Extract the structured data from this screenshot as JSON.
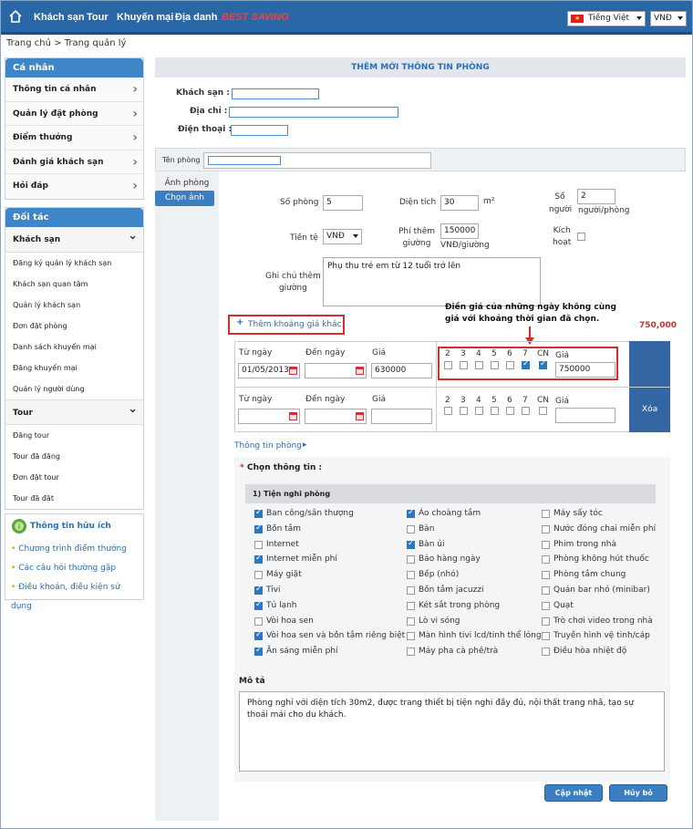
{
  "nav": {
    "items": [
      "Khách sạn",
      "Tour",
      "Khuyến mại",
      "Địa danh"
    ],
    "best": "BEST SAVING",
    "language": "Tiếng Việt",
    "currency": "VNĐ"
  },
  "breadcrumb": {
    "home": "Trang chủ",
    "separator": ">",
    "current": "Trang quản lý"
  },
  "sidebar": {
    "personal_title": "Cá nhân",
    "personal_items": [
      "Thông tin cá nhân",
      "Quản lý đặt phòng",
      "Điểm thưởng",
      "Đánh giá khách sạn",
      "Hỏi đáp"
    ],
    "partner_title": "Đối tác",
    "hotel_group": "Khách sạn",
    "hotel_items": [
      "Đăng ký quản lý khách sạn",
      "Khách sạn quan tâm",
      "Quản lý khách sạn",
      "Đơn đặt phòng",
      "Danh sách khuyến mại",
      "Đăng khuyến mại",
      "Quản lý người dùng"
    ],
    "tour_group": "Tour",
    "tour_items": [
      "Đăng tour",
      "Tour đã đăng",
      "Đơn đặt tour",
      "Tour đã đặt"
    ],
    "info_title": "Thông tin hữu ích",
    "info_links": [
      "Chương trình điểm thưởng",
      "Các câu hỏi thường gặp",
      "Điều khoản, điều kiện sử dụng"
    ]
  },
  "page": {
    "title": "THÊM MỚI THÔNG TIN PHÒNG",
    "hotel_label": "Khách sạn :",
    "address_label": "Địa chỉ :",
    "phone_label": "Điện thoại :",
    "room_name_label": "Tên phòng",
    "tab_images": "Ảnh phòng",
    "tab_choose": "Chọn ảnh"
  },
  "form": {
    "room_count_label": "Số phòng",
    "room_count": "5",
    "area_label": "Diện tích",
    "area": "30",
    "area_unit": "m²",
    "people_label": "Số\nngười",
    "people": "2",
    "people_unit": "người/phòng",
    "currency_label": "Tiền tệ",
    "currency": "VNĐ",
    "bed_fee_label": "Phí thêm\ngiường",
    "bed_fee": "150000",
    "bed_fee_unit": "VNĐ/giường",
    "active_label": "Kích\nhoạt",
    "note_label": "Ghi chú thêm\ngiường",
    "note": "Phụ thu trẻ em từ 12 tuổi trở lên",
    "add_price_link": "Thêm khoảng giá khác",
    "callout": "Điền giá của những ngày không cùng\ngiá với khoảng thời gian đã chọn.",
    "callout_price": "750,000",
    "from_label": "Từ ngày",
    "to_label": "Đến ngày",
    "price_label": "Giá",
    "days": [
      "2",
      "3",
      "4",
      "5",
      "6",
      "7",
      "CN"
    ],
    "row1": {
      "from": "01/05/2013",
      "to": "",
      "price": "630000",
      "day_price": "750000",
      "checked": [
        false,
        false,
        false,
        false,
        false,
        true,
        true
      ]
    },
    "row2": {
      "from": "",
      "to": "",
      "price": "",
      "day_price": "",
      "checked": [
        false,
        false,
        false,
        false,
        false,
        false,
        false
      ]
    },
    "delete_label": "Xóa",
    "room_info_link": "Thông tin phòng"
  },
  "amenities": {
    "choose_label": "Chọn thông tin :",
    "required_mark": "*",
    "group_title": "1) Tiện nghi phòng",
    "col1": [
      {
        "t": "Ban công/sân thượng",
        "c": true
      },
      {
        "t": "Bồn tắm",
        "c": true
      },
      {
        "t": "Internet",
        "c": false
      },
      {
        "t": "Internet miễn phí",
        "c": true
      },
      {
        "t": "Máy giặt",
        "c": false
      },
      {
        "t": "Tivi",
        "c": true
      },
      {
        "t": "Tủ lạnh",
        "c": true
      },
      {
        "t": "Vòi hoa sen",
        "c": false
      },
      {
        "t": "Vòi hoa sen và bồn tắm riêng biệt",
        "c": true
      },
      {
        "t": "Ăn sáng miễn phí",
        "c": true
      }
    ],
    "col2": [
      {
        "t": "Áo choàng tắm",
        "c": true
      },
      {
        "t": "Bàn",
        "c": false
      },
      {
        "t": "Bàn ủi",
        "c": true
      },
      {
        "t": "Báo hàng ngày",
        "c": false
      },
      {
        "t": "Bếp (nhỏ)",
        "c": false
      },
      {
        "t": "Bồn tắm jacuzzi",
        "c": false
      },
      {
        "t": "Két sắt trong phòng",
        "c": false
      },
      {
        "t": "Lò vi sóng",
        "c": false
      },
      {
        "t": "Màn hình tivi lcd/tinh thể lỏng",
        "c": false
      },
      {
        "t": "Máy pha cà phê/trà",
        "c": false
      }
    ],
    "col3": [
      {
        "t": "Máy sấy tóc",
        "c": false
      },
      {
        "t": "Nước đóng chai miễn phí",
        "c": false
      },
      {
        "t": "Phim trong nhà",
        "c": false
      },
      {
        "t": "Phòng không hút thuốc",
        "c": false
      },
      {
        "t": "Phòng tắm chung",
        "c": false
      },
      {
        "t": "Quán bar nhỏ (minibar)",
        "c": false
      },
      {
        "t": "Quạt",
        "c": false
      },
      {
        "t": "Trò chơi video trong nhà",
        "c": false
      },
      {
        "t": "Truyền hình vệ tinh/cáp",
        "c": false
      },
      {
        "t": "Điều hòa nhiệt độ",
        "c": false
      }
    ],
    "desc_label": "Mô tả",
    "description": "Phòng nghỉ với diện tích 30m2, được trang thiết bị tiện nghi đầy đủ, nội thất trang nhã, tạo sự thoải mái cho du khách."
  },
  "buttons": {
    "update": "Cập nhật",
    "cancel": "Hủy bỏ"
  }
}
